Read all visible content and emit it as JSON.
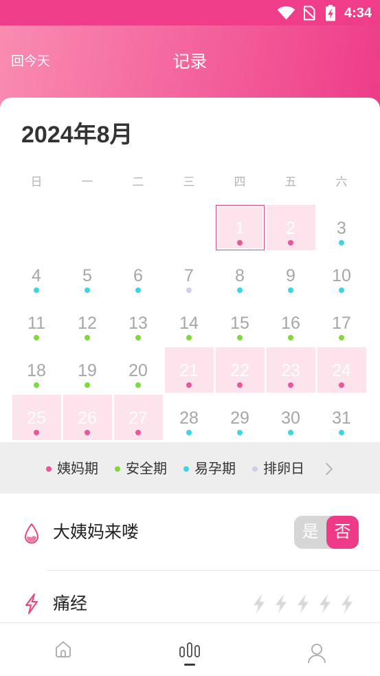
{
  "status_bar": {
    "time": "4:34",
    "icons": [
      "wifi-icon",
      "no-sim-icon",
      "battery-charging-icon"
    ]
  },
  "header": {
    "back_to_today": "回今天",
    "title": "记录"
  },
  "calendar": {
    "month": "2024年8月",
    "weekdays": [
      "日",
      "一",
      "二",
      "三",
      "四",
      "五",
      "六"
    ],
    "selected_day": 1,
    "days": [
      {
        "day": "1",
        "phase": 0
      },
      {
        "day": "2",
        "phase": 0
      },
      {
        "day": "3",
        "phase": 2
      },
      {
        "day": "4",
        "phase": 2
      },
      {
        "day": "5",
        "phase": 2
      },
      {
        "day": "6",
        "phase": 2
      },
      {
        "day": "7",
        "phase": 3
      },
      {
        "day": "8",
        "phase": 2
      },
      {
        "day": "9",
        "phase": 2
      },
      {
        "day": "10",
        "phase": 2
      },
      {
        "day": "11",
        "phase": 1
      },
      {
        "day": "12",
        "phase": 1
      },
      {
        "day": "13",
        "phase": 1
      },
      {
        "day": "14",
        "phase": 1
      },
      {
        "day": "15",
        "phase": 1
      },
      {
        "day": "16",
        "phase": 1
      },
      {
        "day": "17",
        "phase": 1
      },
      {
        "day": "18",
        "phase": 1
      },
      {
        "day": "19",
        "phase": 1
      },
      {
        "day": "20",
        "phase": 1
      },
      {
        "day": "21",
        "phase": 0
      },
      {
        "day": "22",
        "phase": 0
      },
      {
        "day": "23",
        "phase": 0
      },
      {
        "day": "24",
        "phase": 0
      },
      {
        "day": "25",
        "phase": 0
      },
      {
        "day": "26",
        "phase": 0
      },
      {
        "day": "27",
        "phase": 0
      },
      {
        "day": "28",
        "phase": 2
      },
      {
        "day": "29",
        "phase": 2
      },
      {
        "day": "30",
        "phase": 2
      },
      {
        "day": "31",
        "phase": 2
      }
    ]
  },
  "legend": {
    "items": [
      {
        "label": "姨妈期",
        "color": "#e9579a"
      },
      {
        "label": "安全期",
        "color": "#80d93b"
      },
      {
        "label": "易孕期",
        "color": "#3ad7e1"
      },
      {
        "label": "排卵日",
        "color": "#d5cbef"
      }
    ],
    "more_icon": "chevron-right-icon"
  },
  "period_row": {
    "icon": "drop-icon",
    "label": "大姨妈来喽",
    "options": [
      "是",
      "否"
    ],
    "selected_index": 1
  },
  "cramps_row": {
    "icon": "lightning-icon",
    "label": "痛经",
    "rating": {
      "value": 0,
      "max": 5
    }
  },
  "bottom_nav": {
    "items": [
      {
        "icon": "home-icon"
      },
      {
        "icon": "stats-icon"
      },
      {
        "icon": "profile-icon"
      }
    ],
    "active_index": 1
  },
  "colors": {
    "accent": "#ee3a87",
    "period_cell": "#fde3ec",
    "status_bar": "#ef3d89",
    "header_gradient_start": "#f98cb1",
    "header_gradient_end": "#ee3c88"
  }
}
